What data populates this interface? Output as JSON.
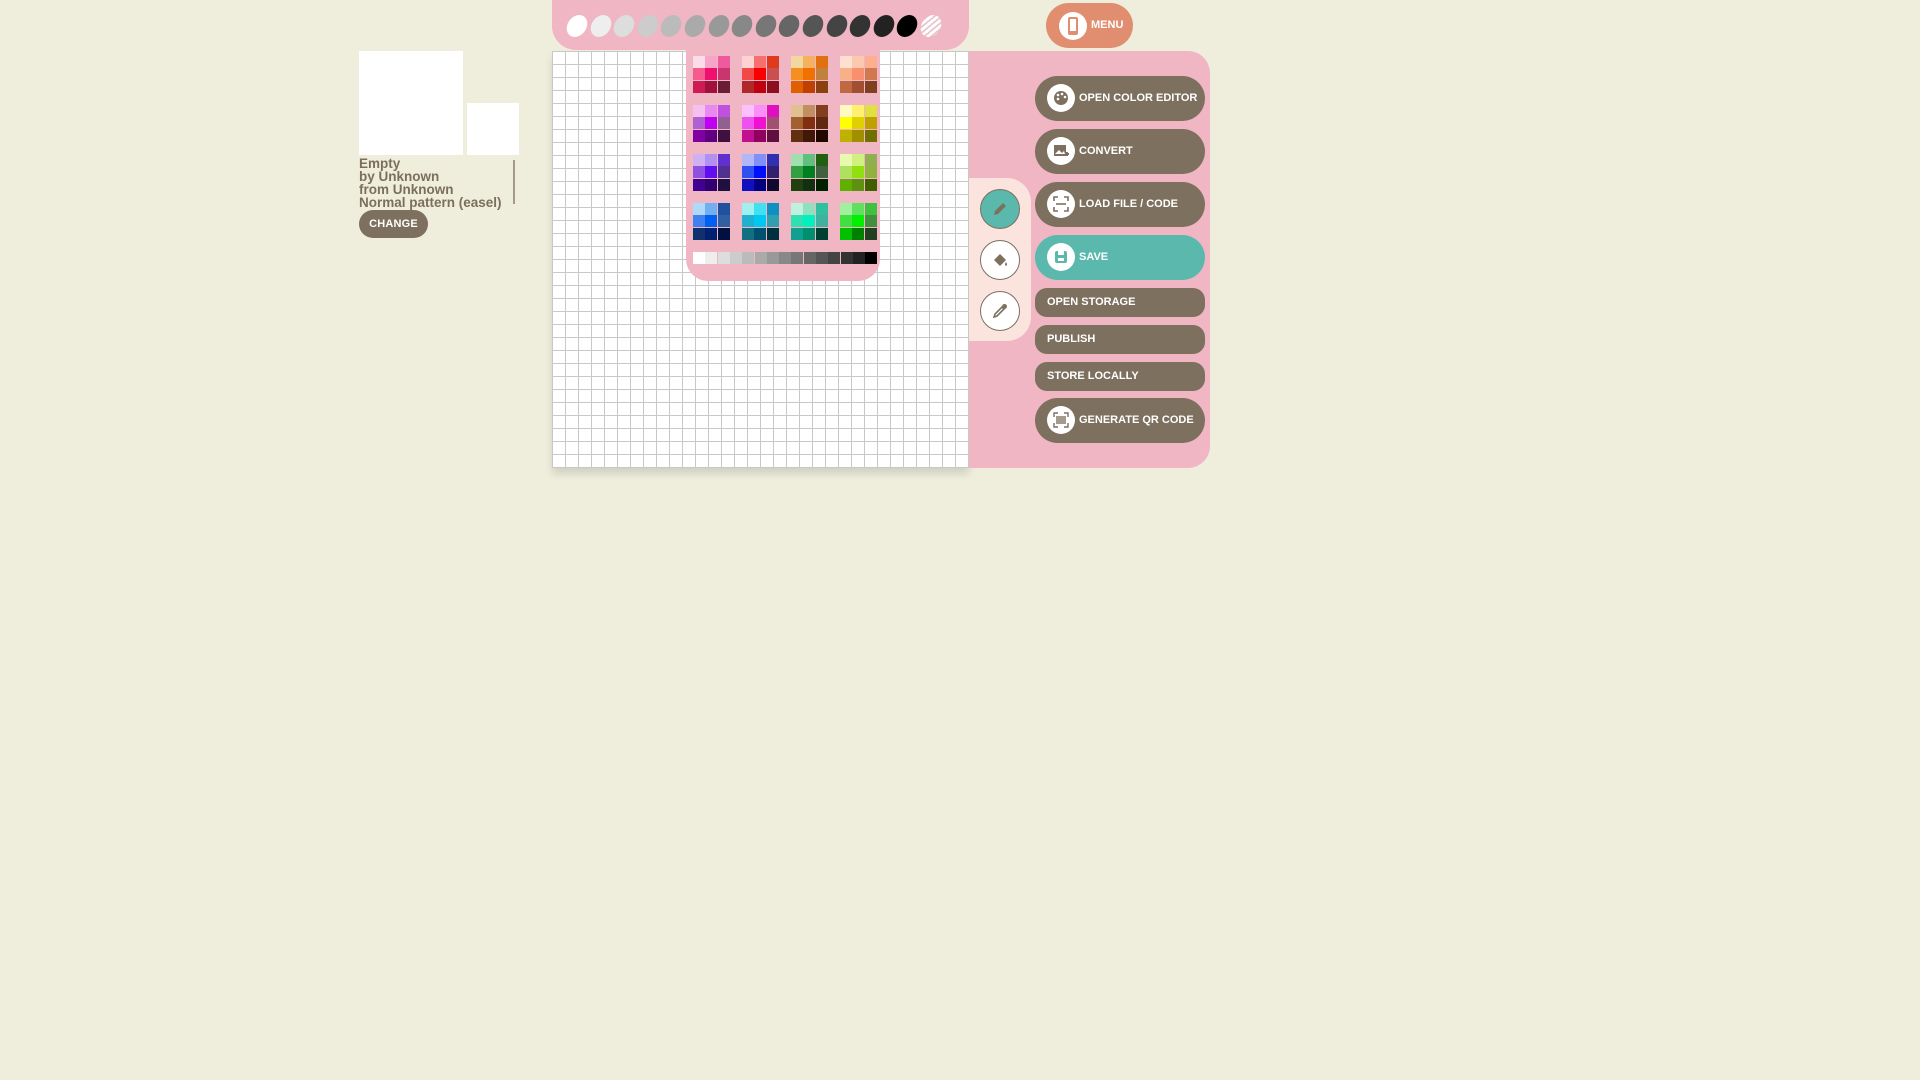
{
  "pattern": {
    "name": "Empty",
    "author": "by Unknown",
    "source": "from Unknown",
    "type": "Normal pattern (easel)",
    "change_label": "CHANGE"
  },
  "menu_label": "MENU",
  "actions": {
    "open_color_editor": "OPEN COLOR EDITOR",
    "convert": "CONVERT",
    "load_file": "LOAD FILE / CODE",
    "save": "SAVE",
    "open_storage": "OPEN STORAGE",
    "publish": "PUBLISH",
    "store_locally": "STORE LOCALLY",
    "generate_qr": "GENERATE QR CODE"
  },
  "tools": [
    "pencil-icon",
    "paint-bucket-icon",
    "eyedropper-icon"
  ],
  "active_tool": "pencil",
  "colors": {
    "background": "#efeedc",
    "pink_panel": "#f0b6c3",
    "brown_button": "#7d705f",
    "teal_accent": "#5bb8ac",
    "menu_button": "#e18e70"
  },
  "current_palette": [
    "#ffffff",
    "#eeeeee",
    "#dddddd",
    "#cccccc",
    "#bbbbbb",
    "#aaaaaa",
    "#999999",
    "#888888",
    "#777777",
    "#666666",
    "#555555",
    "#444444",
    "#333333",
    "#222222",
    "#000000",
    "transparent"
  ],
  "palette_blocks": [
    [
      "#fddcea",
      "#f6a5c8",
      "#ef5a9e",
      "#f55b8f",
      "#ee0f6e",
      "#c9366e",
      "#cf1b55",
      "#a0103e",
      "#6a1d35"
    ],
    [
      "#fdd2d2",
      "#f77070",
      "#e03a1e",
      "#f34848",
      "#fb0000",
      "#c85050",
      "#b02828",
      "#c00010",
      "#8a1020"
    ],
    [
      "#f0d8a0",
      "#f5b060",
      "#e07010",
      "#f59020",
      "#f07000",
      "#c08040",
      "#e06000",
      "#c04000",
      "#8a4010"
    ],
    [
      "#fde0d0",
      "#fcc8b0",
      "#fcb090",
      "#f8b088",
      "#f89070",
      "#d07850",
      "#c06840",
      "#a05030",
      "#804020"
    ],
    [
      "#f5c0f0",
      "#e888f0",
      "#c050e0",
      "#b060d0",
      "#c000f0",
      "#906090",
      "#8000a0",
      "#600080",
      "#401040"
    ],
    [
      "#fcc0fc",
      "#f890f8",
      "#e010c0",
      "#f050f0",
      "#f010d0",
      "#a05070",
      "#c01090",
      "#900060",
      "#601040"
    ],
    [
      "#e0c090",
      "#c09060",
      "#804020",
      "#a06030",
      "#803010",
      "#602810",
      "#603010",
      "#401808",
      "#200800"
    ],
    [
      "#fffac0",
      "#fff070",
      "#e0e040",
      "#ffff00",
      "#e0d000",
      "#c0a000",
      "#c0b000",
      "#a09000",
      "#707000"
    ],
    [
      "#d0b0f0",
      "#b090f0",
      "#6030d0",
      "#9050e0",
      "#6010f0",
      "#503090",
      "#400090",
      "#300070",
      "#201040"
    ],
    [
      "#b0b8f8",
      "#8090f8",
      "#3030b0",
      "#3050f0",
      "#0010f8",
      "#302070",
      "#1010c0",
      "#000080",
      "#100830"
    ],
    [
      "#a0e0b0",
      "#60c080",
      "#206010",
      "#30a040",
      "#008020",
      "#406040",
      "#204010",
      "#103010",
      "#002000"
    ],
    [
      "#e8fab0",
      "#d0f080",
      "#90b050",
      "#b0e060",
      "#90e010",
      "#90b040",
      "#60b000",
      "#609010",
      "#406000"
    ],
    [
      "#b0d8f8",
      "#70b0f0",
      "#2050a0",
      "#4080f0",
      "#0060f0",
      "#3060a0",
      "#103070",
      "#002070",
      "#001040"
    ],
    [
      "#a0f0f0",
      "#40e0f0",
      "#1090c0",
      "#20b0d0",
      "#00c8f0",
      "#30a0b0",
      "#107080",
      "#005070",
      "#003040"
    ],
    [
      "#c0f0e0",
      "#90e0c0",
      "#30c0a0",
      "#30e0b0",
      "#00f0c0",
      "#40b0a0",
      "#10a090",
      "#009070",
      "#004030"
    ],
    [
      "#a0f0a0",
      "#60e060",
      "#40c040",
      "#40e040",
      "#00f000",
      "#409040",
      "#00c000",
      "#008000",
      "#204020"
    ]
  ],
  "grey_strip": [
    "#ffffff",
    "#eeeeee",
    "#dddddd",
    "#cccccc",
    "#bbbbbb",
    "#aaaaaa",
    "#999999",
    "#888888",
    "#777777",
    "#666666",
    "#555555",
    "#444444",
    "#333333",
    "#222222",
    "#000000"
  ]
}
